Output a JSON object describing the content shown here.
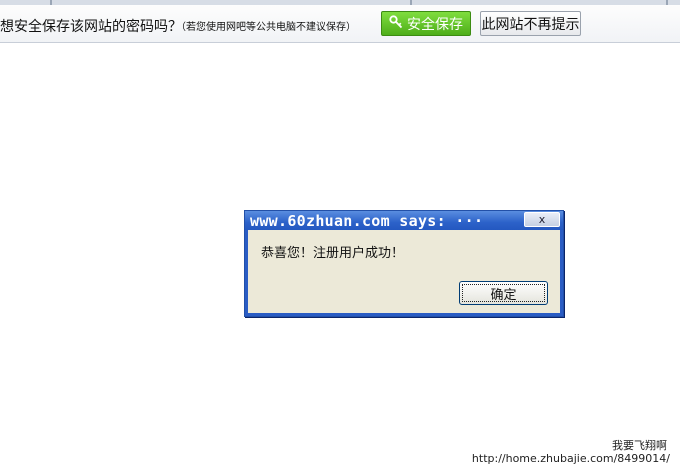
{
  "infobar": {
    "question": "想安全保存该网站的密码吗？",
    "note": "（若您使用网吧等公共电脑不建议保存）",
    "save_button": "安全保存",
    "save_icon": "key-icon",
    "never_button": "此网站不再提示"
  },
  "dialog": {
    "title": "www.60zhuan.com says: ···",
    "close_label": "x",
    "message": "恭喜您！注册用户成功！",
    "ok_button": "确定"
  },
  "watermark": {
    "name": "我要飞翔啊",
    "url": "http://home.zhubajie.com/8499014/"
  }
}
